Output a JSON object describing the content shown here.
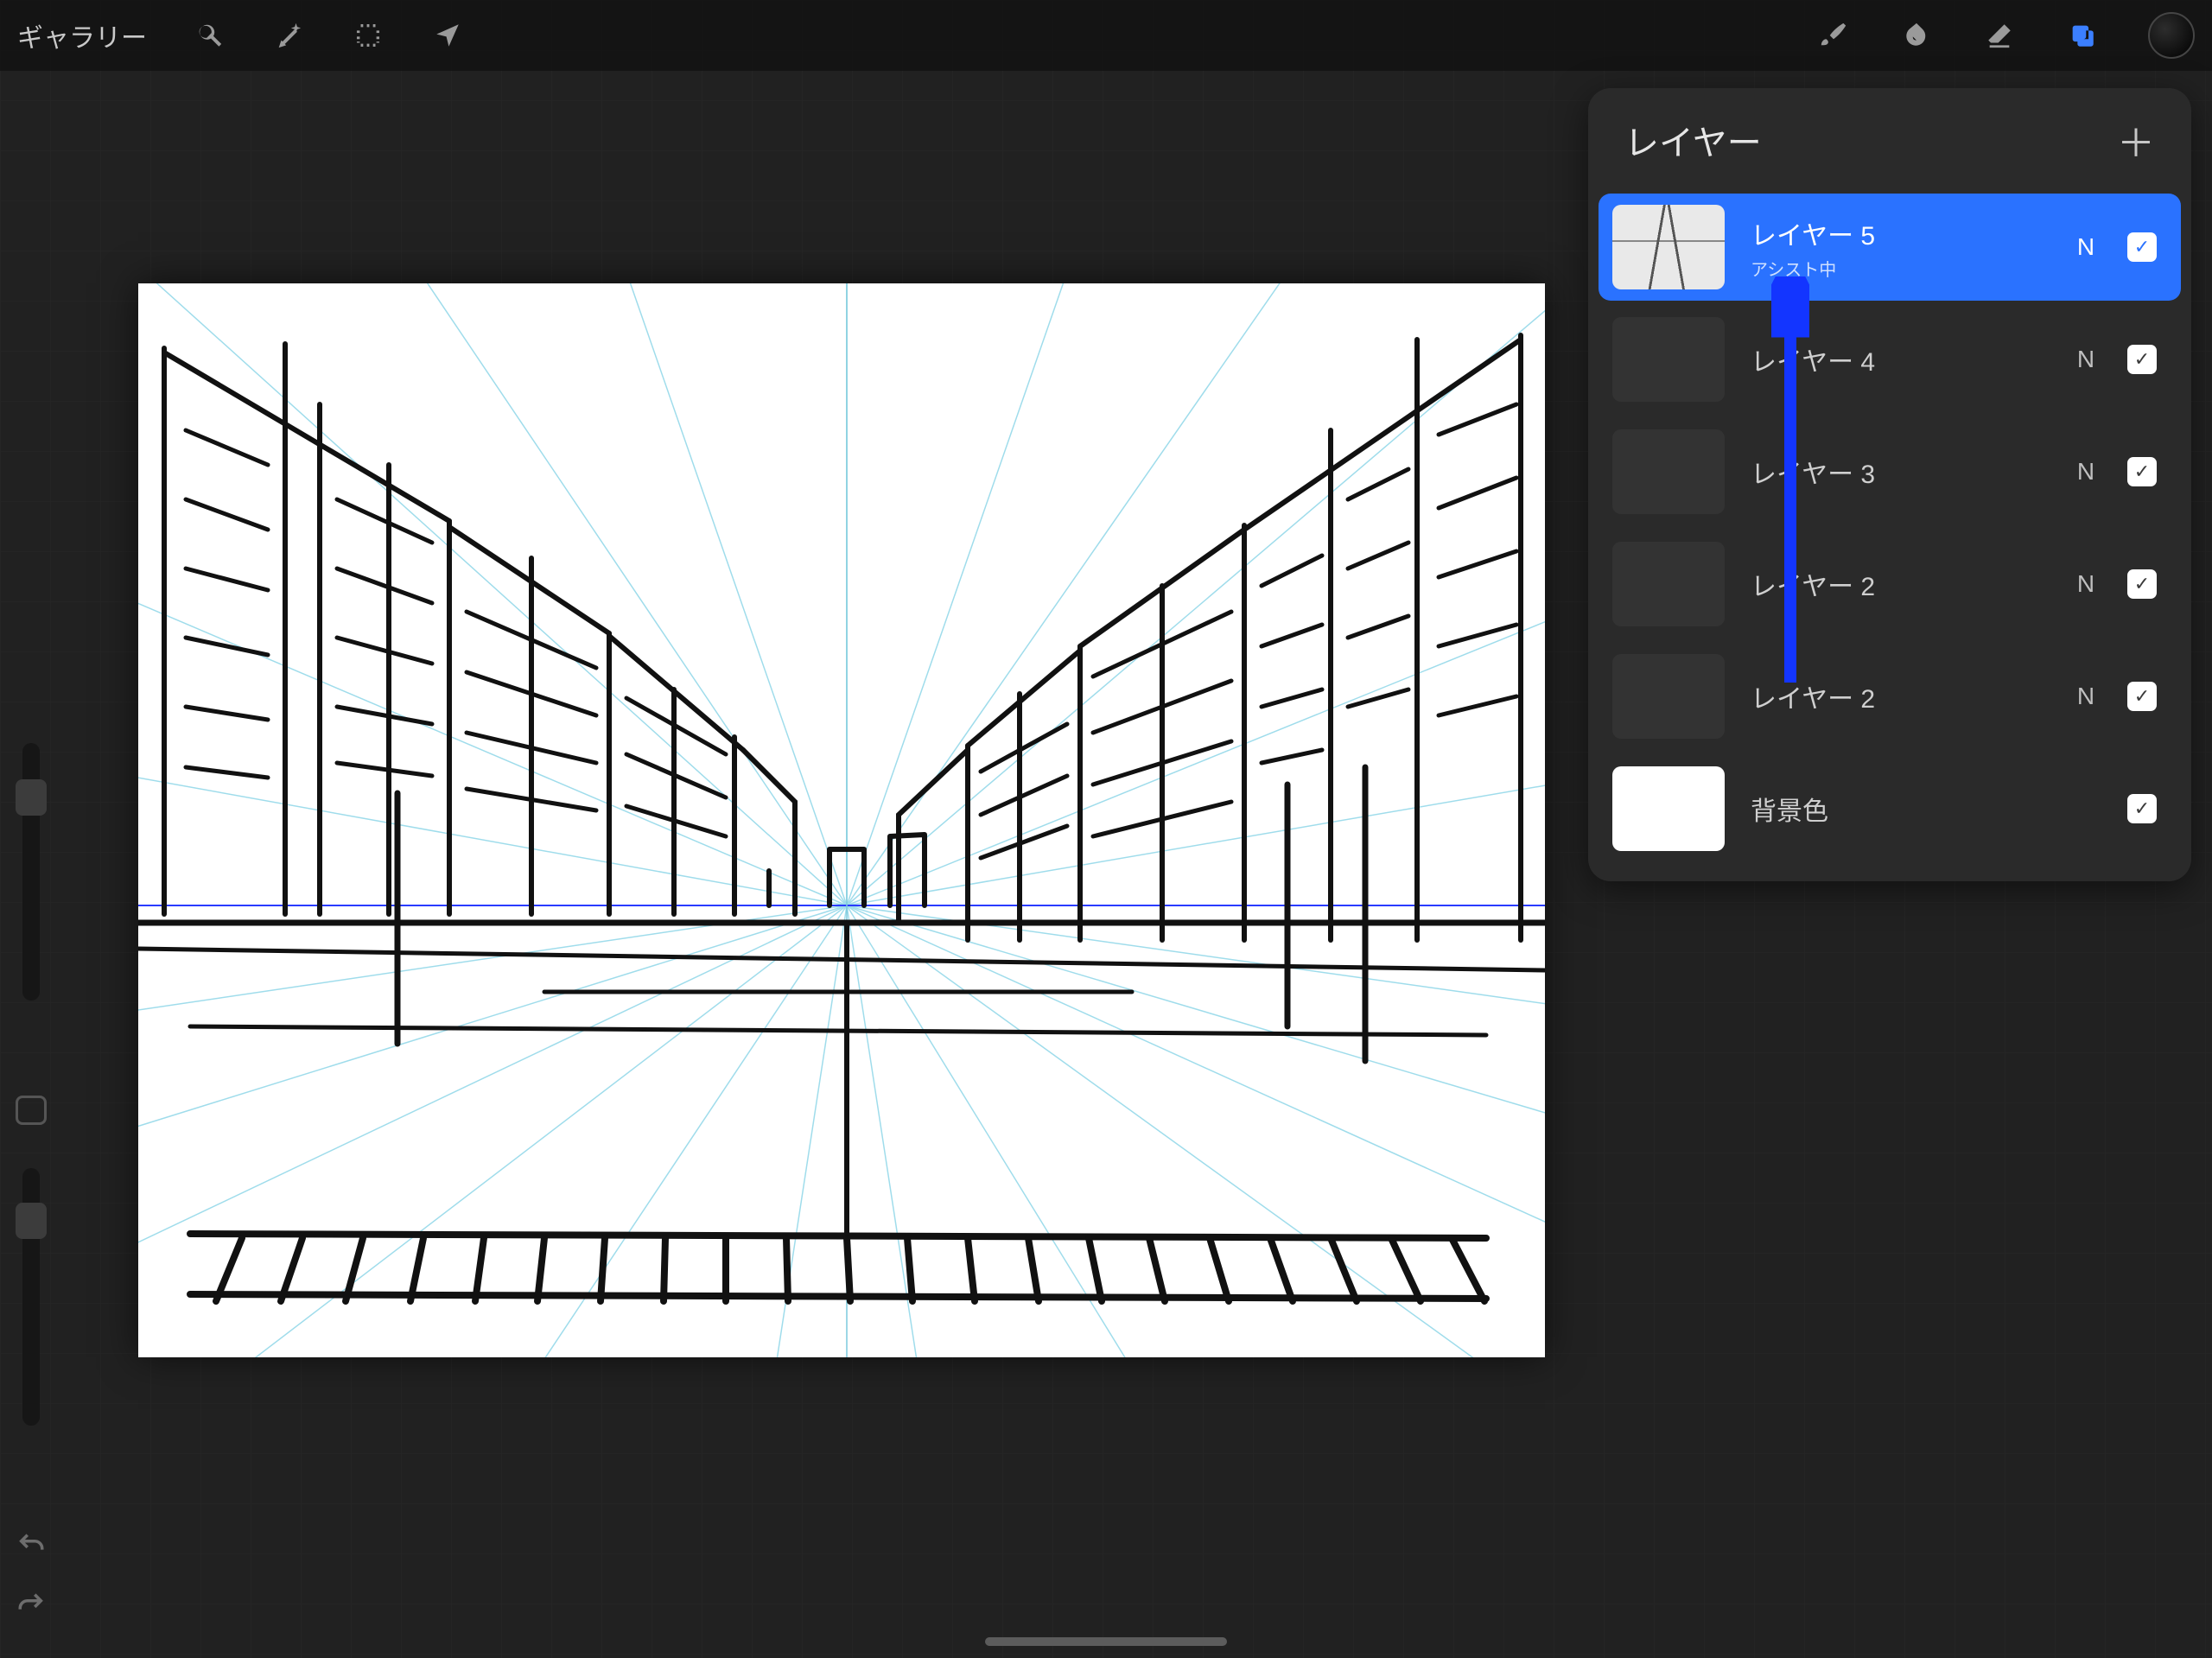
{
  "toolbar": {
    "gallery_label": "ギャラリー"
  },
  "layers_panel": {
    "title": "レイヤー"
  },
  "layers": [
    {
      "name": "レイヤー 5",
      "sub": "アシスト中",
      "blend": "N",
      "visible": true,
      "selected": true,
      "thumb": "sketch"
    },
    {
      "name": "レイヤー 4",
      "sub": "",
      "blend": "N",
      "visible": true,
      "selected": false,
      "thumb": "dark"
    },
    {
      "name": "レイヤー 3",
      "sub": "",
      "blend": "N",
      "visible": true,
      "selected": false,
      "thumb": "dark"
    },
    {
      "name": "レイヤー 2",
      "sub": "",
      "blend": "N",
      "visible": true,
      "selected": false,
      "thumb": "dark"
    },
    {
      "name": "レイヤー 2",
      "sub": "",
      "blend": "N",
      "visible": true,
      "selected": false,
      "thumb": "dark"
    },
    {
      "name": "背景色",
      "sub": "",
      "blend": "",
      "visible": true,
      "selected": false,
      "thumb": "white"
    }
  ]
}
